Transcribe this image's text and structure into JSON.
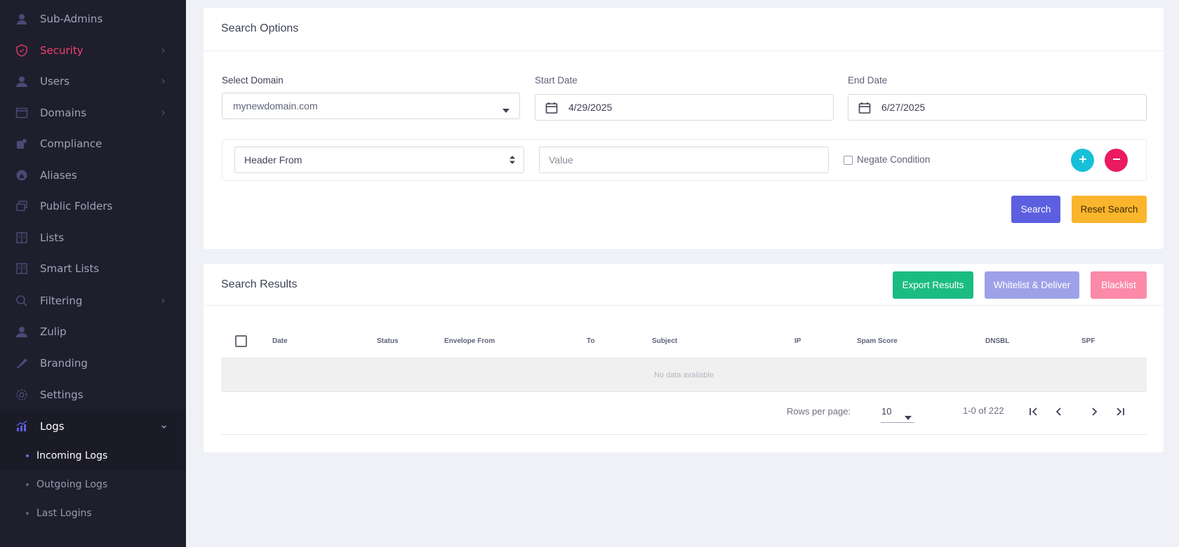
{
  "sidebar": {
    "items": [
      {
        "label": "Sub-Admins",
        "icon": "user-icon"
      },
      {
        "label": "Security",
        "icon": "shield-icon"
      },
      {
        "label": "Users",
        "icon": "users-icon"
      },
      {
        "label": "Domains",
        "icon": "window-icon"
      },
      {
        "label": "Compliance",
        "icon": "compliance-icon"
      },
      {
        "label": "Aliases",
        "icon": "aliases-icon"
      },
      {
        "label": "Public Folders",
        "icon": "folders-icon"
      },
      {
        "label": "Lists",
        "icon": "list-icon"
      },
      {
        "label": "Smart Lists",
        "icon": "list-icon"
      },
      {
        "label": "Filtering",
        "icon": "search-icon"
      },
      {
        "label": "Zulip",
        "icon": "users-icon"
      },
      {
        "label": "Branding",
        "icon": "branding-icon"
      },
      {
        "label": "Settings",
        "icon": "gear-icon"
      },
      {
        "label": "Logs",
        "icon": "chart-icon"
      }
    ],
    "logs_subitems": [
      {
        "label": "Incoming Logs"
      },
      {
        "label": "Outgoing Logs"
      },
      {
        "label": "Last Logins"
      }
    ]
  },
  "search_options": {
    "title": "Search Options",
    "domain_label": "Select Domain",
    "domain_value": "mynewdomain.com",
    "start_label": "Start Date",
    "start_value": "4/29/2025",
    "end_label": "End Date",
    "end_value": "6/27/2025",
    "condition_field": "Header From",
    "value_placeholder": "Value",
    "negate_label": "Negate Condition",
    "search_button": "Search",
    "reset_button": "Reset Search"
  },
  "search_results": {
    "title": "Search Results",
    "export_button": "Export Results",
    "whitelist_button": "Whitelist & Deliver",
    "blacklist_button": "Blacklist",
    "columns": [
      "Date",
      "Status",
      "Envelope From",
      "To",
      "Subject",
      "IP",
      "Spam Score",
      "DNSBL",
      "SPF"
    ],
    "empty_text": "No data available",
    "rows_per_page_label": "Rows per page:",
    "rows_per_page_value": "10",
    "page_info": "1-0 of 222"
  },
  "colors": {
    "sidebar_bg": "#1e1e2d",
    "security_active": "#f1416c",
    "search_btn": "#5c5fdf",
    "reset_btn": "#fbb52d",
    "export_btn": "#1bbc82",
    "whitelist_btn": "#9fa1e8",
    "blacklist_btn": "#fb8aa9",
    "add_btn": "#17c0d8",
    "remove_btn": "#ea1b60"
  }
}
